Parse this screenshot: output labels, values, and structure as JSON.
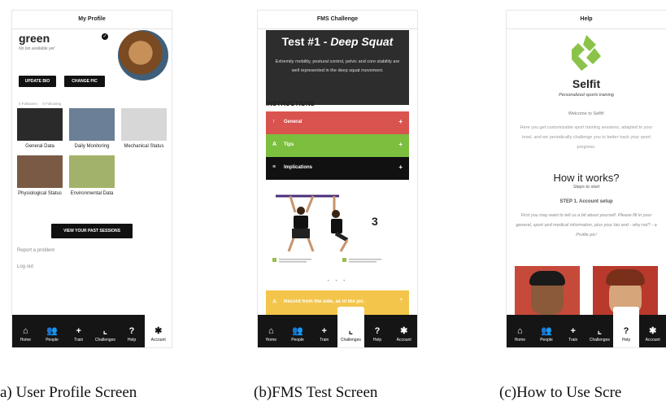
{
  "nav_items": [
    {
      "label": "Home",
      "icon": "home-icon",
      "glyph": "⌂"
    },
    {
      "label": "People",
      "icon": "people-icon",
      "glyph": "👥"
    },
    {
      "label": "Train",
      "icon": "plus-icon",
      "glyph": "+"
    },
    {
      "label": "Challenges",
      "icon": "chart-icon",
      "glyph": "⌞"
    },
    {
      "label": "Help",
      "icon": "question-icon",
      "glyph": "?"
    },
    {
      "label": "Account",
      "icon": "gear-icon",
      "glyph": "✱"
    }
  ],
  "profile": {
    "title": "My Profile",
    "name": "green",
    "bio": "No bio available yet",
    "update_bio": "UPDATE BIO",
    "change_pic": "CHANGE PIC",
    "followers": "0 Followers",
    "following": "0 Following",
    "tiles": [
      {
        "label": "General Data",
        "color": "#2a2a2a"
      },
      {
        "label": "Daily Monitoring",
        "color": "#6b7f96"
      },
      {
        "label": "Mechanical Status",
        "color": "#d7d7d7"
      },
      {
        "label": "Physiological Status",
        "color": "#7a5a44"
      },
      {
        "label": "Environmental Data",
        "color": "#a2b26a"
      }
    ],
    "past_sessions": "VIEW YOUR PAST SESSIONS",
    "report": "Report a problem",
    "logout": "Log out"
  },
  "fms": {
    "title": "FMS Challenge",
    "test_prefix": "Test #1 - ",
    "test_name": "Deep Squat",
    "description": "Extremity mobility, postural control, pelvic and core stability are well represented in the deep squat movement.",
    "instructions": "INSTRUCTIONS",
    "accordions": [
      {
        "label": "General",
        "color": "#d9534f",
        "glyph": "↑"
      },
      {
        "label": "Tips",
        "color": "#7cbf3f",
        "glyph": "A"
      },
      {
        "label": "Implications",
        "color": "#111111",
        "glyph": "≡"
      }
    ],
    "score": "3",
    "dots": "• • •",
    "warning": "Record from the side, as in the pic."
  },
  "help": {
    "title": "Help",
    "app_name": "Selfit",
    "tagline": "Personalized sports training",
    "welcome": "Welcome to Selfit!",
    "intro": "Here you get customizable sport training sessions, adapted to your level, and we periodically challenge you to better track your sport progress.",
    "how": "How it works?",
    "steps": "Steps to start",
    "step1": "STEP 1. Account setup",
    "step1_text": "First you may want to tell us a bit about yourself. Please fill in your general, sport and medical information, plus your bio and - why not? - a Profile pic!"
  },
  "captions": [
    "a) User Profile Screen",
    "(b)FMS Test Screen",
    "(c)How to Use Scre"
  ],
  "colors": {
    "accent_green": "#8bc34a",
    "dark": "#151515",
    "warning": "#f3c54a"
  }
}
